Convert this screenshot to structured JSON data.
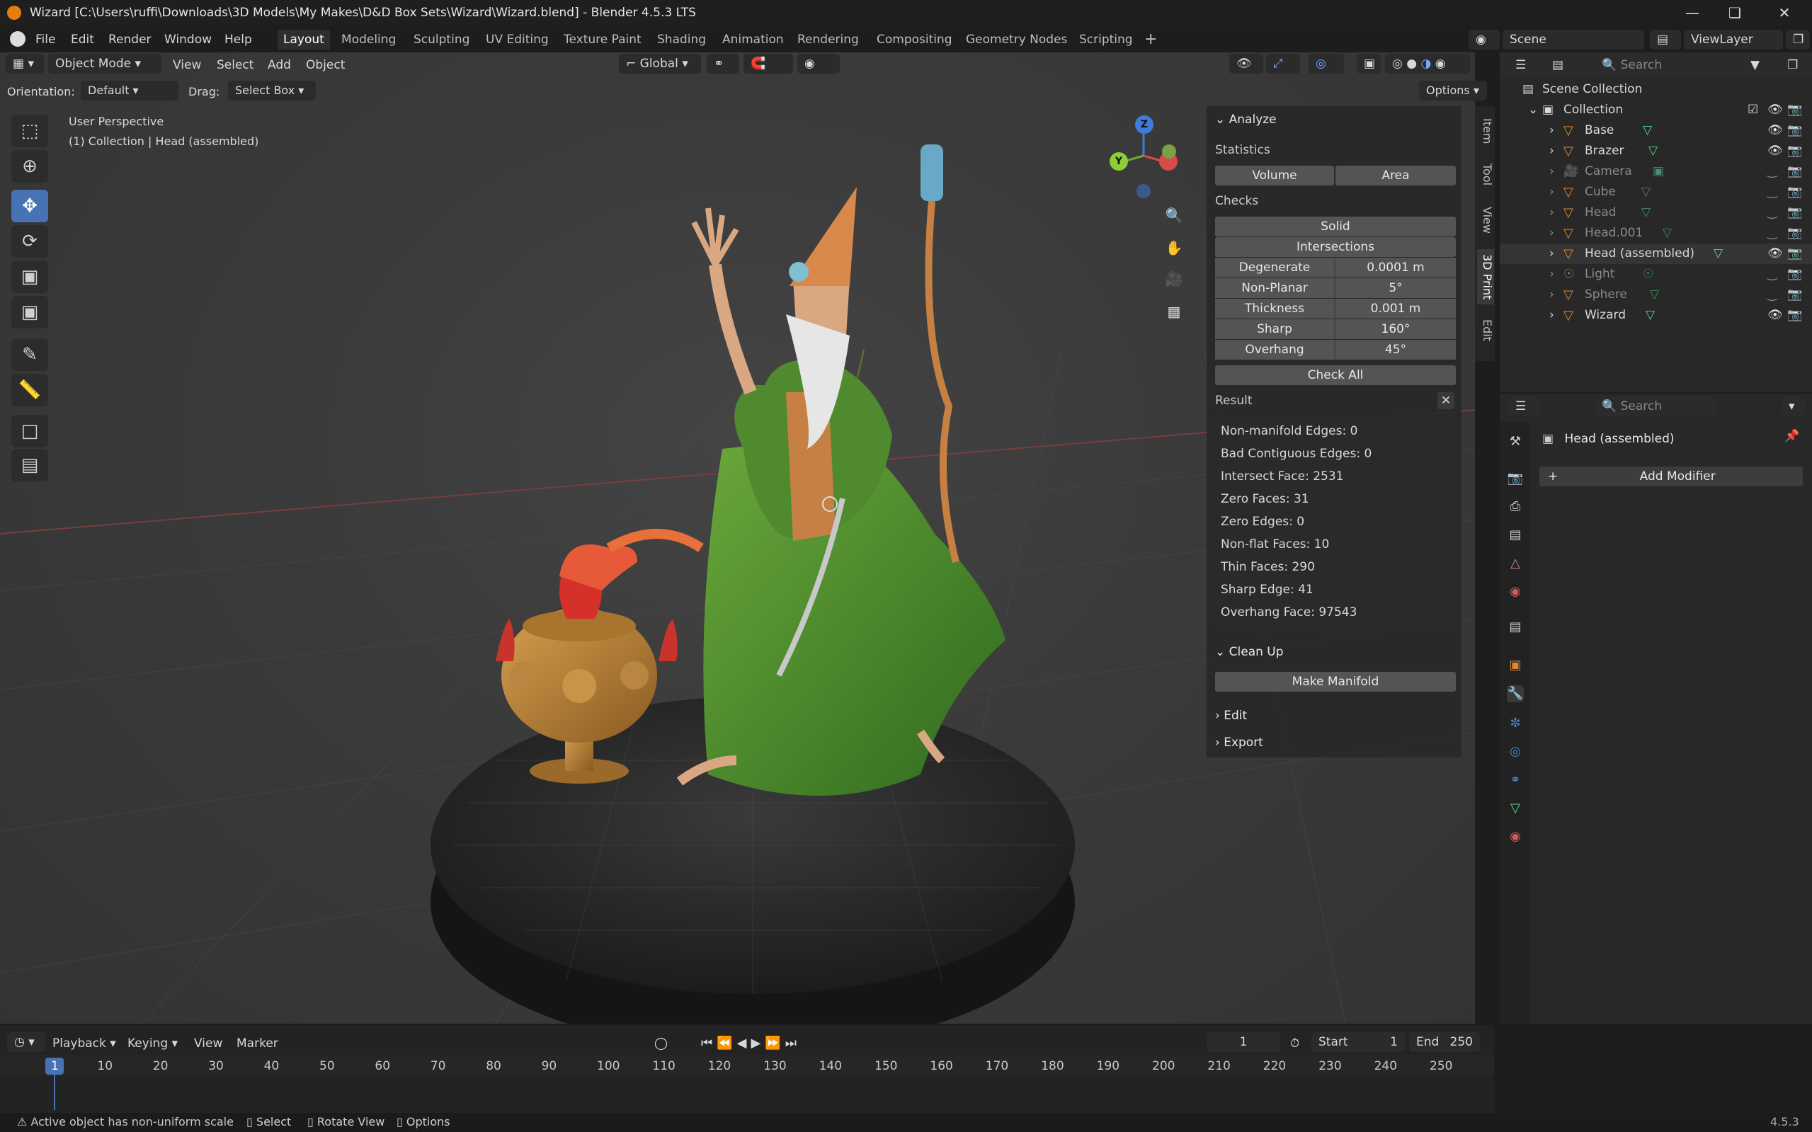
{
  "window": {
    "title": "Wizard [C:\\Users\\ruffi\\Downloads\\3D Models\\My Makes\\D&D Box Sets\\Wizard\\Wizard.blend] - Blender 4.5.3 LTS"
  },
  "menu": [
    "File",
    "Edit",
    "Render",
    "Window",
    "Help"
  ],
  "workspaces": [
    "Layout",
    "Modeling",
    "Sculpting",
    "UV Editing",
    "Texture Paint",
    "Shading",
    "Animation",
    "Rendering",
    "Compositing",
    "Geometry Nodes",
    "Scripting"
  ],
  "scene": {
    "name": "Scene",
    "view_layer": "ViewLayer"
  },
  "viewport_header": {
    "mode": "Object Mode",
    "menus": [
      "View",
      "Select",
      "Add",
      "Object"
    ],
    "transform": "Global",
    "orientation_label": "Orientation:",
    "orientation_value": "Default",
    "drag_label": "Drag:",
    "drag_value": "Select Box",
    "options": "Options"
  },
  "viewport": {
    "perspective": "User Perspective",
    "context": "(1) Collection | Head (assembled)",
    "axes": {
      "x": "X",
      "y": "Y",
      "z": "Z"
    }
  },
  "npanel": {
    "tabs": [
      "Item",
      "Tool",
      "View",
      "3D Print",
      "Edit"
    ],
    "analyze": "Analyze",
    "statistics": "Statistics",
    "volume": "Volume",
    "area": "Area",
    "checks": "Checks",
    "solid": "Solid",
    "intersections": "Intersections",
    "fields": [
      {
        "label": "Degenerate",
        "value": "0.0001 m"
      },
      {
        "label": "Non-Planar",
        "value": "5°"
      },
      {
        "label": "Thickness",
        "value": "0.001 m"
      },
      {
        "label": "Sharp",
        "value": "160°"
      },
      {
        "label": "Overhang",
        "value": "45°"
      }
    ],
    "check_all": "Check All",
    "result": "Result",
    "results": [
      "Non-manifold Edges: 0",
      "Bad Contiguous Edges: 0",
      "Intersect Face: 2531",
      "Zero Faces: 31",
      "Zero Edges: 0",
      "Non-flat Faces: 10",
      "Thin Faces: 290",
      "Sharp Edge: 41",
      "Overhang Face: 97543"
    ],
    "clean_up": "Clean Up",
    "make_manifold": "Make Manifold",
    "edit": "Edit",
    "export": "Export"
  },
  "outliner": {
    "search_placeholder": "Search",
    "scene_collection": "Scene Collection",
    "collection": "Collection",
    "items": [
      {
        "name": "Base",
        "visible": true
      },
      {
        "name": "Brazer",
        "visible": true
      },
      {
        "name": "Camera",
        "visible": false
      },
      {
        "name": "Cube",
        "visible": false
      },
      {
        "name": "Head",
        "visible": false
      },
      {
        "name": "Head.001",
        "visible": false
      },
      {
        "name": "Head (assembled)",
        "visible": true
      },
      {
        "name": "Light",
        "visible": false
      },
      {
        "name": "Sphere",
        "visible": false
      },
      {
        "name": "Wizard",
        "visible": true
      }
    ]
  },
  "properties": {
    "search_placeholder": "Search",
    "object_name": "Head (assembled)",
    "add_modifier": "Add Modifier"
  },
  "timeline": {
    "menus": [
      "Playback",
      "Keying",
      "View",
      "Marker"
    ],
    "current_frame": "1",
    "start_label": "Start",
    "start": "1",
    "end_label": "End",
    "end": "250",
    "ticks": [
      "1",
      "10",
      "20",
      "30",
      "40",
      "50",
      "60",
      "70",
      "80",
      "90",
      "100",
      "110",
      "120",
      "130",
      "140",
      "150",
      "160",
      "170",
      "180",
      "190",
      "200",
      "210",
      "220",
      "230",
      "240",
      "250"
    ]
  },
  "statusbar": {
    "warning": "Active object has non-uniform scale",
    "select": "Select",
    "rotate": "Rotate View",
    "options": "Options",
    "version": "4.5.3"
  },
  "colors": {
    "accent": "#4772b3",
    "orange": "#e87d0d",
    "robe_green": "#4f8a2e",
    "flame_red": "#d5302a",
    "brass": "#c08a3a",
    "base_dark": "#2a2a2a"
  }
}
